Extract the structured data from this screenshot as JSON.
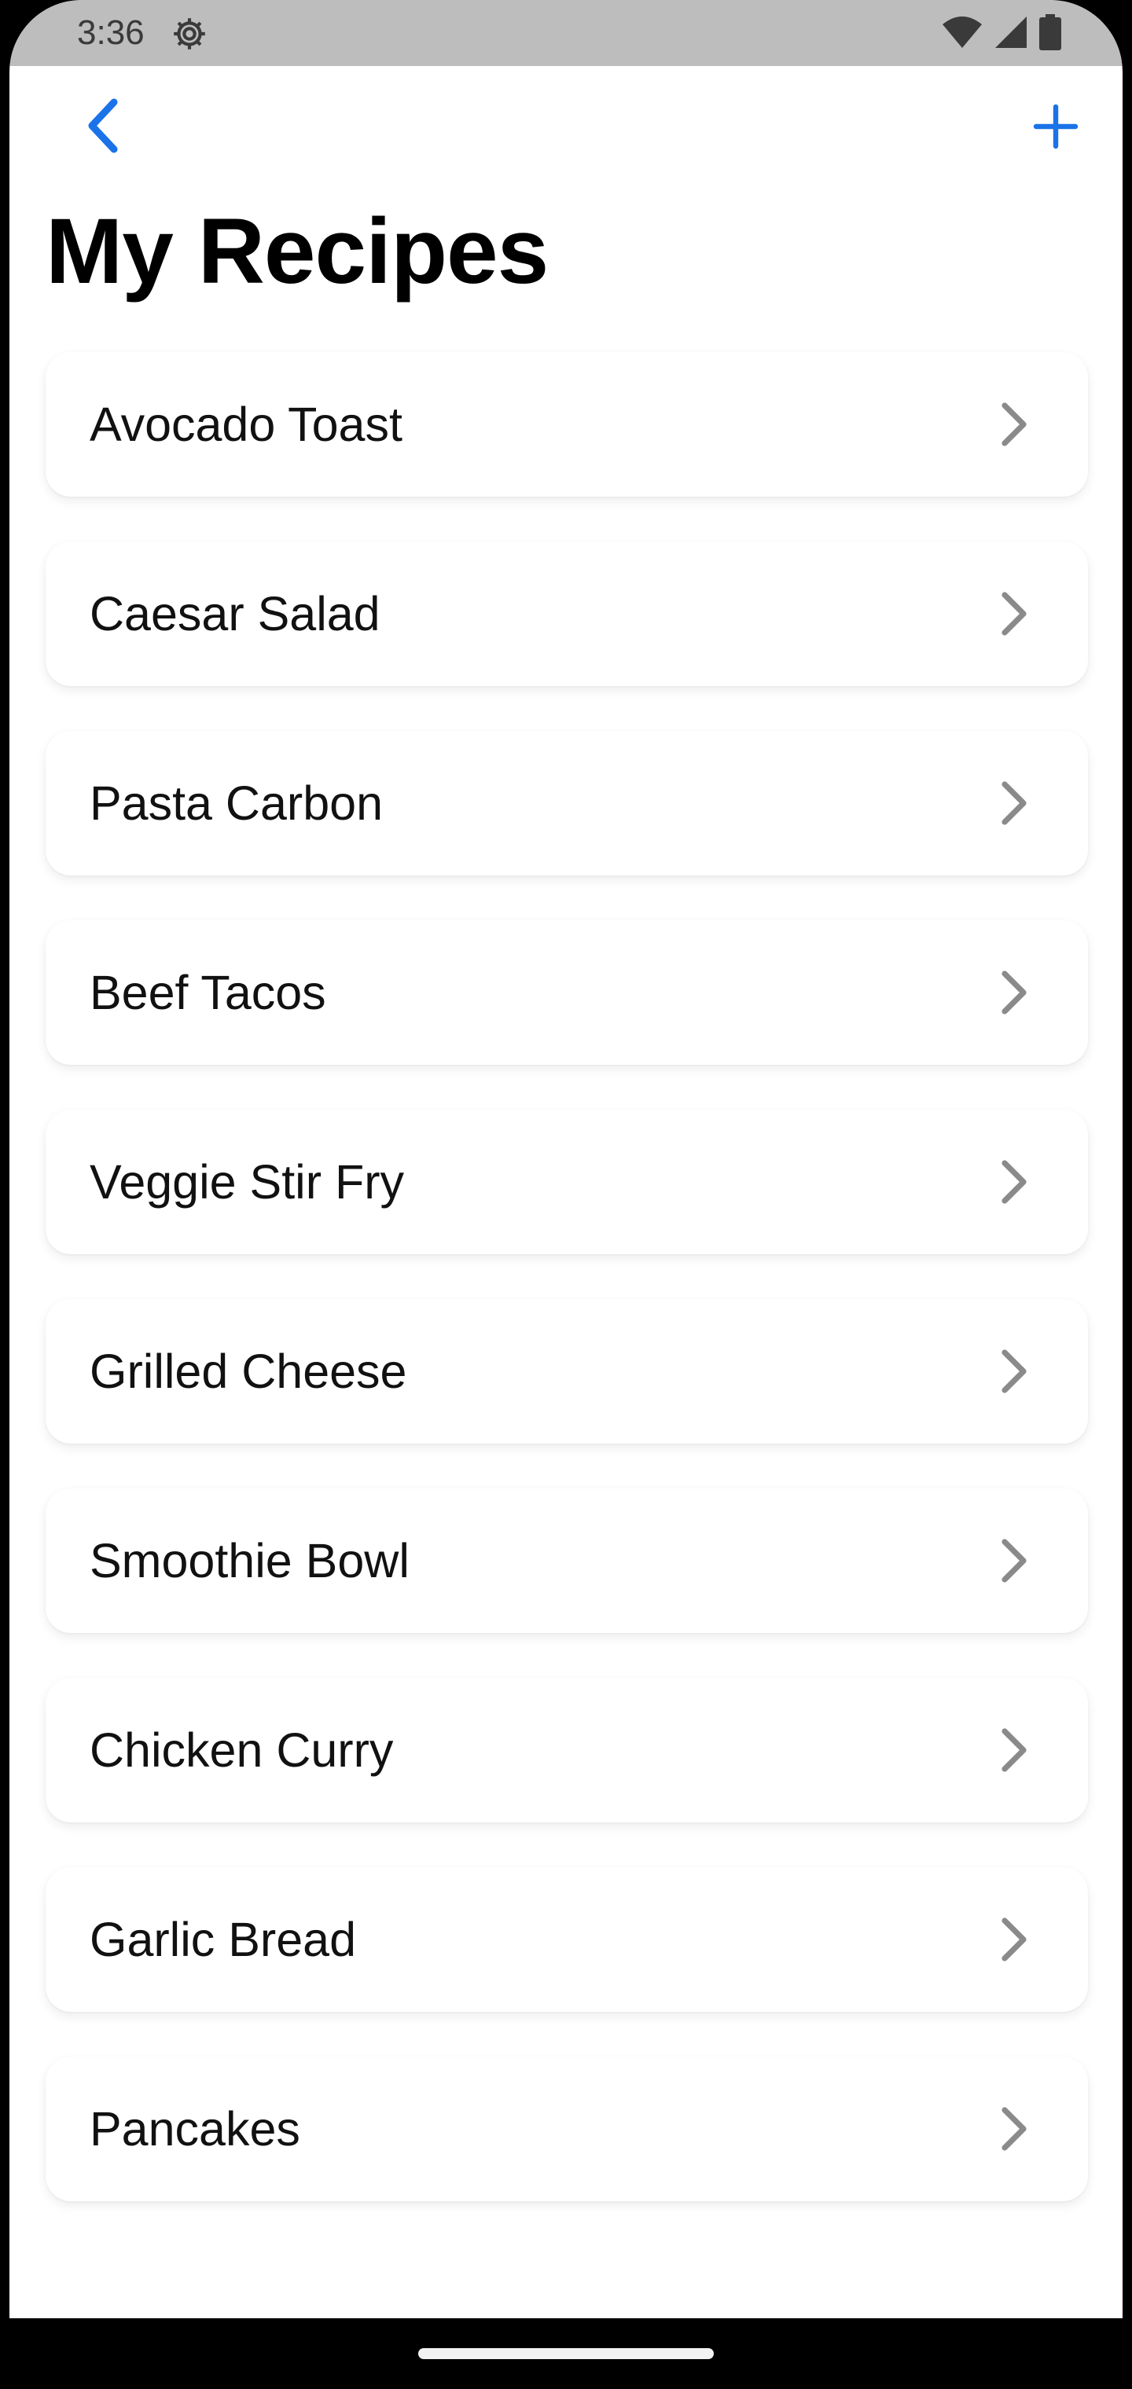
{
  "status_bar": {
    "time": "3:36",
    "icons": [
      "settings-gear-icon",
      "wifi-icon",
      "cellular-signal-icon",
      "battery-icon"
    ],
    "background": "#bdbdbd"
  },
  "nav": {
    "back_icon": "chevron-left-icon",
    "add_icon": "plus-icon",
    "accent_color": "#1a73e8"
  },
  "page": {
    "title": "My Recipes"
  },
  "recipes": [
    {
      "name": "Avocado Toast"
    },
    {
      "name": "Caesar Salad"
    },
    {
      "name": "Pasta Carbon"
    },
    {
      "name": "Beef Tacos"
    },
    {
      "name": "Veggie Stir Fry"
    },
    {
      "name": "Grilled Cheese"
    },
    {
      "name": "Smoothie Bowl"
    },
    {
      "name": "Chicken Curry"
    },
    {
      "name": "Garlic Bread"
    },
    {
      "name": "Pancakes"
    }
  ],
  "item_icon": "chevron-right-icon"
}
